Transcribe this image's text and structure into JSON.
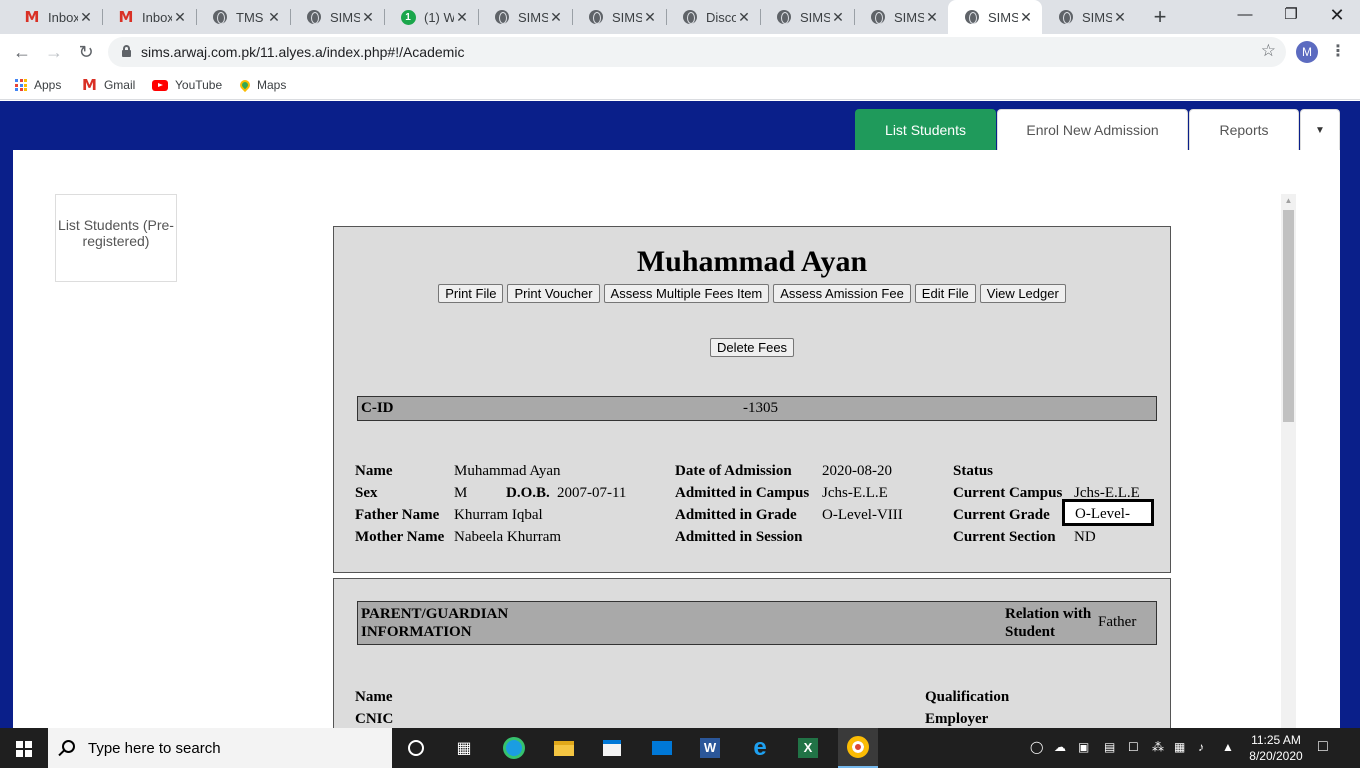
{
  "browser": {
    "tabs": [
      {
        "title": "Inbox",
        "icon": "gmail-icon"
      },
      {
        "title": "Inbox",
        "icon": "gmail-icon"
      },
      {
        "title": "TMS",
        "icon": "globe-icon"
      },
      {
        "title": "SIMS",
        "icon": "globe-icon"
      },
      {
        "title": "(1) W",
        "icon": "whatsapp-icon",
        "badge": "1"
      },
      {
        "title": "SIMS",
        "icon": "globe-icon"
      },
      {
        "title": "SIMS",
        "icon": "globe-icon"
      },
      {
        "title": "Disco",
        "icon": "globe-icon"
      },
      {
        "title": "SIMS",
        "icon": "globe-icon"
      },
      {
        "title": "SIMS",
        "icon": "globe-icon"
      },
      {
        "title": "SIMS",
        "icon": "globe-icon",
        "active": true
      },
      {
        "title": "SIMS",
        "icon": "globe-icon"
      }
    ],
    "url": "sims.arwaj.com.pk/11.alyes.a/index.php#!/Academic",
    "profile_initial": "M",
    "bookmarks": [
      {
        "label": "Apps"
      },
      {
        "label": "Gmail"
      },
      {
        "label": "YouTube"
      },
      {
        "label": "Maps"
      }
    ]
  },
  "nav": {
    "tabs": [
      {
        "label": "List Students",
        "active": true
      },
      {
        "label": "Enrol New Admission"
      },
      {
        "label": "Reports"
      }
    ],
    "dropdown_icon": "caret-down-icon"
  },
  "sidebar": {
    "link": "List Students (Pre-registered)"
  },
  "student": {
    "name": "Muhammad Ayan",
    "buttons": [
      "Print File",
      "Print Voucher",
      "Assess Multiple Fees Item",
      "Assess Amission Fee",
      "Edit File",
      "View Ledger"
    ],
    "delete_button": "Delete Fees",
    "cid_label": "C-ID",
    "cid_value": "-1305",
    "fields": {
      "name_label": "Name",
      "name_value": "Muhammad Ayan",
      "sex_label": "Sex",
      "sex_value": "M",
      "dob_label": "D.O.B.",
      "dob_value": "2007-07-11",
      "father_label": "Father Name",
      "father_value": "Khurram Iqbal",
      "mother_label": "Mother Name",
      "mother_value": "Nabeela Khurram",
      "doa_label": "Date of Admission",
      "doa_value": "2020-08-20",
      "campus_label": "Admitted in Campus",
      "campus_value": "Jchs-E.L.E",
      "grade_label": "Admitted in Grade",
      "grade_value": "O-Level-VIII",
      "session_label": "Admitted in Session",
      "session_value": "",
      "status_label": "Status",
      "status_value": "",
      "current_campus_label": "Current Campus",
      "current_campus_value": "Jchs-E.L.E",
      "current_grade_label": "Current Grade",
      "current_grade_value": "O-Level-",
      "current_section_label": "Current Section",
      "current_section_value": "ND"
    }
  },
  "parent": {
    "header": "PARENT/GUARDIAN INFORMATION",
    "relation_label": "Relation with Student",
    "relation_value": "Father",
    "name_label": "Name",
    "cnic_label": "CNIC",
    "qualification_label": "Qualification",
    "employer_label": "Employer"
  },
  "taskbar": {
    "search_placeholder": "Type here to search",
    "time": "11:25 AM",
    "date": "8/20/2020"
  }
}
